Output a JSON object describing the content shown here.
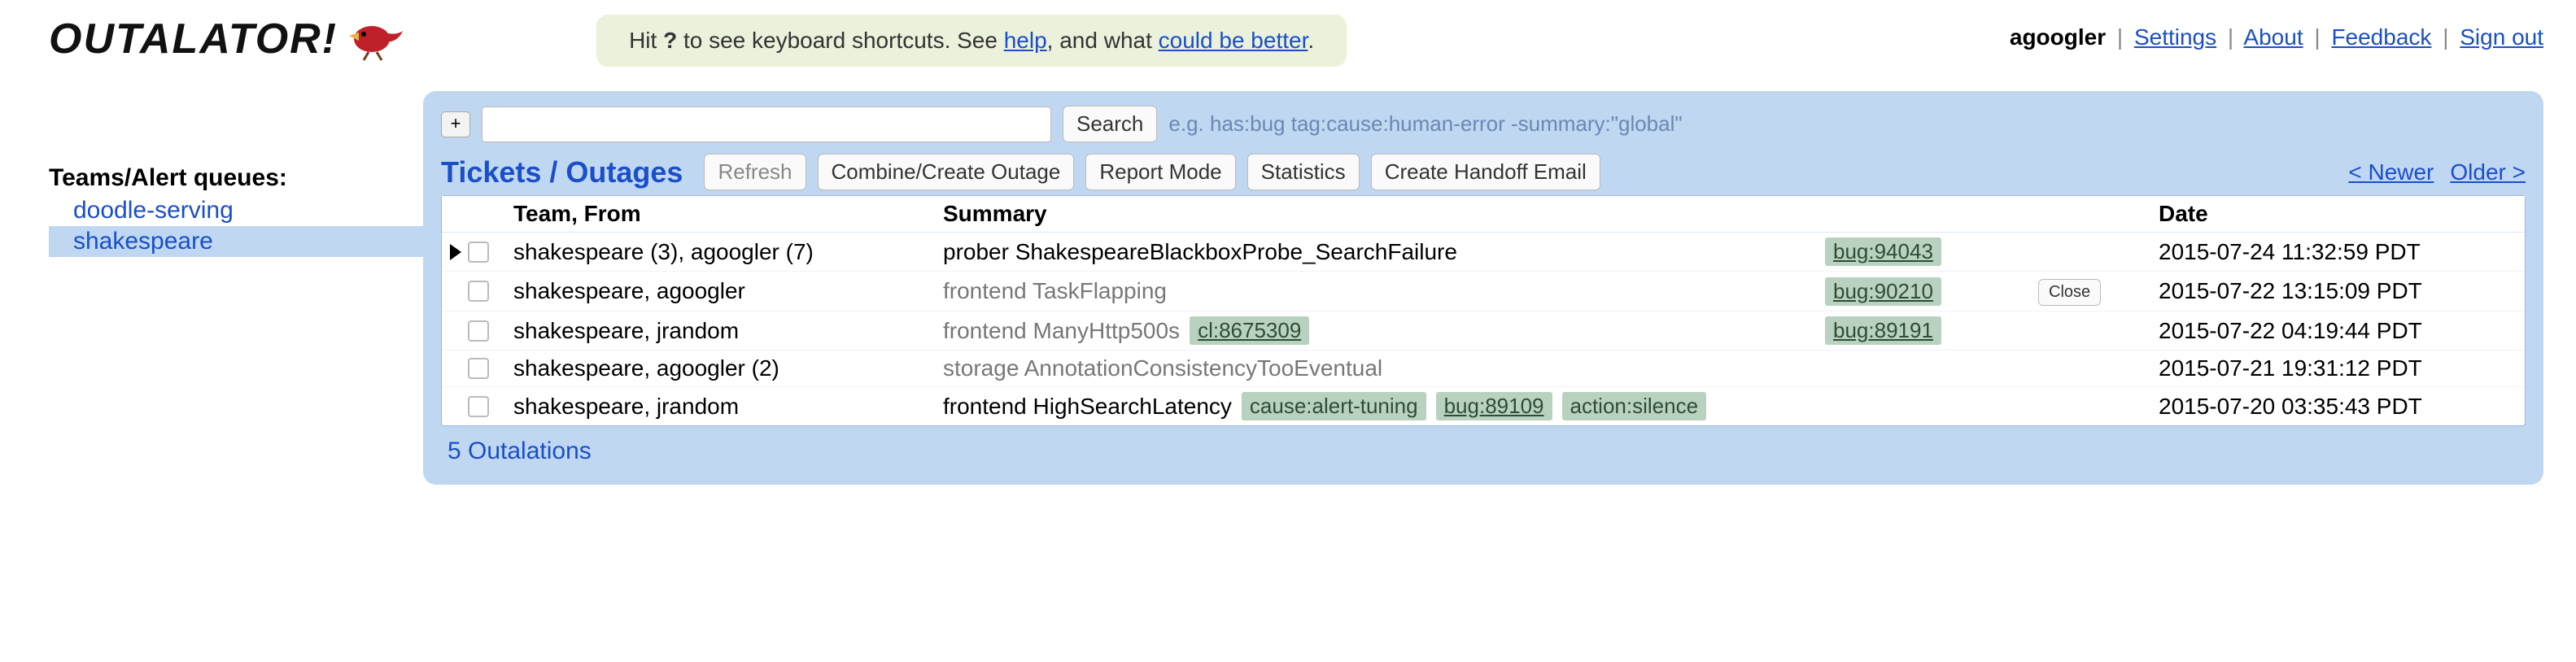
{
  "app_title": "OUTALATOR!",
  "hint": {
    "prefix": "Hit ",
    "key": "?",
    "mid1": " to see keyboard shortcuts. See ",
    "help": "help",
    "mid2": ", and what ",
    "better": "could be better",
    "suffix": "."
  },
  "user": {
    "name": "agoogler",
    "links": [
      "Settings",
      "About",
      "Feedback",
      "Sign out"
    ]
  },
  "sidebar": {
    "title": "Teams/Alert queues:",
    "items": [
      {
        "label": "doodle-serving",
        "active": false
      },
      {
        "label": "shakespeare",
        "active": true
      }
    ]
  },
  "search": {
    "plus": "+",
    "button": "Search",
    "hint": "e.g. has:bug tag:cause:human-error -summary:\"global\""
  },
  "section": {
    "title": "Tickets / Outages",
    "refresh": "Refresh",
    "combine": "Combine/Create Outage",
    "report": "Report Mode",
    "stats": "Statistics",
    "handoff": "Create Handoff Email",
    "newer": "< Newer",
    "older": "Older >"
  },
  "columns": {
    "team": "Team, From",
    "summary": "Summary",
    "date": "Date"
  },
  "rows": [
    {
      "pointer": true,
      "team": "shakespeare (3), agoogler (7)",
      "summary": "prober ShakespeareBlackboxProbe_SearchFailure",
      "tags": [],
      "bug": "bug:94043",
      "action": "",
      "date": "2015-07-24 11:32:59 PDT",
      "grey": false
    },
    {
      "pointer": false,
      "team": "shakespeare, agoogler",
      "summary": "frontend TaskFlapping",
      "tags": [],
      "bug": "bug:90210",
      "action": "Close",
      "date": "2015-07-22 13:15:09 PDT",
      "grey": true
    },
    {
      "pointer": false,
      "team": "shakespeare, jrandom",
      "summary": "frontend ManyHttp500s",
      "tags": [
        {
          "text": "cl:8675309",
          "link": true
        }
      ],
      "bug": "bug:89191",
      "action": "",
      "date": "2015-07-22 04:19:44 PDT",
      "grey": true
    },
    {
      "pointer": false,
      "team": "shakespeare, agoogler (2)",
      "summary": "storage AnnotationConsistencyTooEventual",
      "tags": [],
      "bug": "",
      "action": "",
      "date": "2015-07-21 19:31:12 PDT",
      "grey": true
    },
    {
      "pointer": false,
      "team": "shakespeare, jrandom",
      "summary": "frontend HighSearchLatency",
      "tags": [
        {
          "text": "cause:alert-tuning",
          "link": false
        },
        {
          "text": "bug:89109",
          "link": true
        },
        {
          "text": "action:silence",
          "link": false
        }
      ],
      "bug": "",
      "action": "",
      "date": "2015-07-20 03:35:43 PDT",
      "grey": false
    }
  ],
  "footer_count": "5 Outalations"
}
